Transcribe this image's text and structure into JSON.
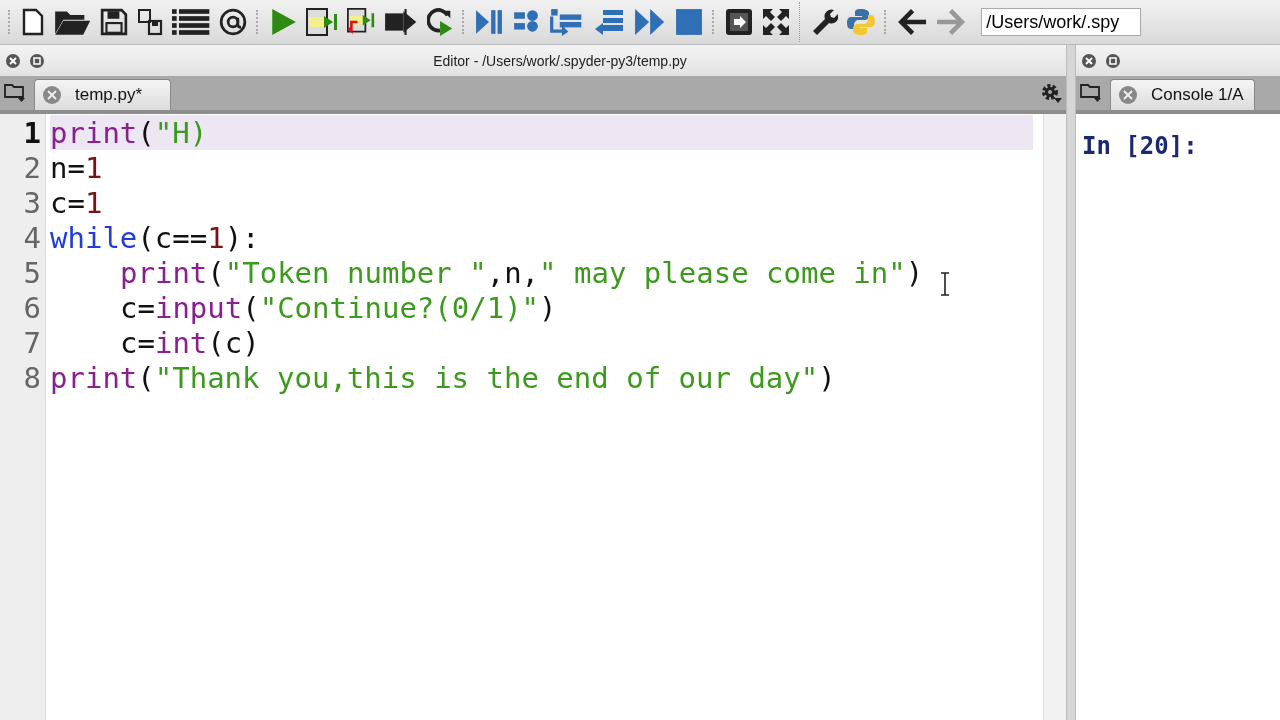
{
  "toolbar": {
    "path_field": {
      "value": "/Users/work/.spy"
    }
  },
  "editor": {
    "title": "Editor - /Users/work/.spyder-py3/temp.py",
    "tabs": [
      {
        "label": "temp.py*",
        "selected": true
      }
    ],
    "lines": [
      {
        "number": "1",
        "current": true,
        "indented": false,
        "tokens": [
          {
            "kind": "builtin",
            "text": "print"
          },
          {
            "kind": "plain",
            "text": "("
          },
          {
            "kind": "string",
            "text": "\"H)"
          }
        ]
      },
      {
        "number": "2",
        "current": false,
        "indented": false,
        "tokens": [
          {
            "kind": "plain",
            "text": "n="
          },
          {
            "kind": "number",
            "text": "1"
          }
        ]
      },
      {
        "number": "3",
        "current": false,
        "indented": false,
        "tokens": [
          {
            "kind": "plain",
            "text": "c="
          },
          {
            "kind": "number",
            "text": "1"
          }
        ]
      },
      {
        "number": "4",
        "current": false,
        "indented": false,
        "tokens": [
          {
            "kind": "keyword",
            "text": "while"
          },
          {
            "kind": "plain",
            "text": "(c=="
          },
          {
            "kind": "number",
            "text": "1"
          },
          {
            "kind": "plain",
            "text": "):"
          }
        ]
      },
      {
        "number": "5",
        "current": false,
        "indented": true,
        "tokens": [
          {
            "kind": "builtin",
            "text": "print"
          },
          {
            "kind": "plain",
            "text": "("
          },
          {
            "kind": "string",
            "text": "\"Token number \""
          },
          {
            "kind": "plain",
            "text": ",n,"
          },
          {
            "kind": "string",
            "text": "\" may please come in\""
          },
          {
            "kind": "plain",
            "text": ")"
          }
        ]
      },
      {
        "number": "6",
        "current": false,
        "indented": true,
        "tokens": [
          {
            "kind": "plain",
            "text": "c="
          },
          {
            "kind": "builtin",
            "text": "input"
          },
          {
            "kind": "plain",
            "text": "("
          },
          {
            "kind": "string",
            "text": "\"Continue?(0/1)\""
          },
          {
            "kind": "plain",
            "text": ")"
          }
        ]
      },
      {
        "number": "7",
        "current": false,
        "indented": true,
        "tokens": [
          {
            "kind": "plain",
            "text": "c="
          },
          {
            "kind": "builtin",
            "text": "int"
          },
          {
            "kind": "plain",
            "text": "(c)"
          }
        ]
      },
      {
        "number": "8",
        "current": false,
        "indented": false,
        "tokens": [
          {
            "kind": "builtin",
            "text": "print"
          },
          {
            "kind": "plain",
            "text": "("
          },
          {
            "kind": "string",
            "text": "\"Thank you,this is the end of our day\""
          },
          {
            "kind": "plain",
            "text": ")"
          }
        ]
      }
    ]
  },
  "console": {
    "tabs": [
      {
        "label": "Console 1/A",
        "selected": true
      }
    ],
    "prompt": "In [20]:"
  }
}
